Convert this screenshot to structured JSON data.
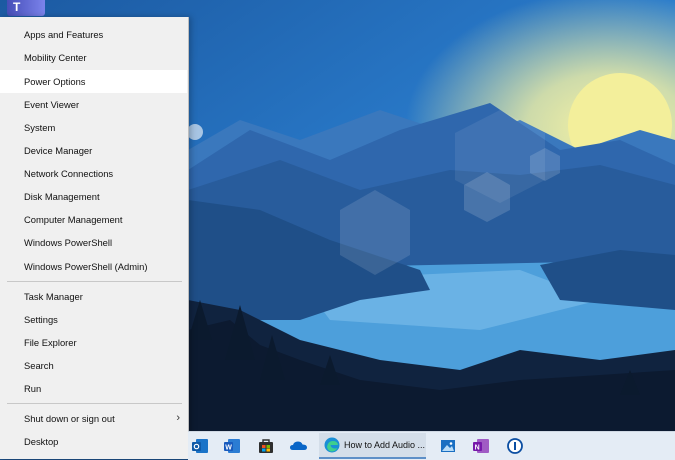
{
  "menu": {
    "items": [
      {
        "label": "Apps and Features"
      },
      {
        "label": "Mobility Center"
      },
      {
        "label": "Power Options"
      },
      {
        "label": "Event Viewer"
      },
      {
        "label": "System"
      },
      {
        "label": "Device Manager"
      },
      {
        "label": "Network Connections"
      },
      {
        "label": "Disk Management"
      },
      {
        "label": "Computer Management"
      },
      {
        "label": "Windows PowerShell"
      },
      {
        "label": "Windows PowerShell (Admin)"
      },
      {
        "label": "Task Manager"
      },
      {
        "label": "Settings"
      },
      {
        "label": "File Explorer"
      },
      {
        "label": "Search"
      },
      {
        "label": "Run"
      },
      {
        "label": "Shut down or sign out"
      },
      {
        "label": "Desktop"
      }
    ],
    "highlighted": "Power Options"
  },
  "desktop_icon": {
    "letter": "T",
    "icon": "teams-icon"
  },
  "taskbar": {
    "edge_window_title": "How to Add Audio ...",
    "icons": [
      "outlook-icon",
      "word-icon",
      "store-icon",
      "onedrive-icon",
      "edge-icon",
      "photos-icon",
      "onenote-icon",
      "password-manager-icon"
    ]
  },
  "colors": {
    "menu_bg": "#f0f0f0",
    "highlight": "#ffffff",
    "taskbar_bg": "#e4ecf5",
    "sky_top": "#1e5a9e",
    "sun": "#f2ee9a"
  }
}
